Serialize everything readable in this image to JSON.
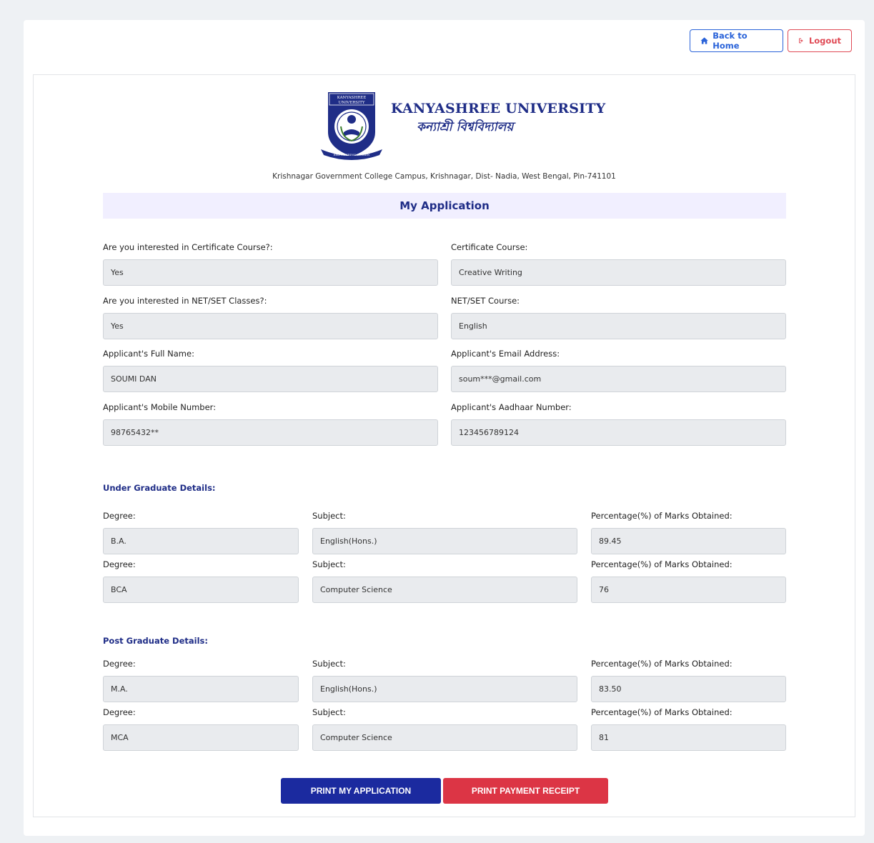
{
  "header": {
    "back_home_label": "Back to Home",
    "logout_label": "Logout"
  },
  "university": {
    "name_en": "KANYASHREE UNIVERSITY",
    "name_bn": "কন্যাশ্রী বিশ্ববিদ্যালয়",
    "logo_top_text": "KANYASHREE UNIVERSITY",
    "logo_ribbon_text": "EMPOWERING WOMEN",
    "address": "Krishnagar Government College Campus, Krishnagar, Dist- Nadia, West Bengal, Pin-741101"
  },
  "page_title": "My Application",
  "personal": {
    "cert_interest_label": "Are you interested in Certificate Course?:",
    "cert_interest_value": "Yes",
    "cert_course_label": "Certificate Course:",
    "cert_course_value": "Creative Writing",
    "netset_interest_label": "Are you interested in NET/SET Classes?:",
    "netset_interest_value": "Yes",
    "netset_course_label": "NET/SET Course:",
    "netset_course_value": "English",
    "name_label": "Applicant's Full Name:",
    "name_value": "SOUMI DAN",
    "email_label": "Applicant's Email Address:",
    "email_value": "soum***@gmail.com",
    "mobile_label": "Applicant's Mobile Number:",
    "mobile_value": "98765432**",
    "aadhaar_label": "Applicant's Aadhaar Number:",
    "aadhaar_value": "123456789124"
  },
  "ug": {
    "title": "Under Graduate Details:",
    "degree_label": "Degree:",
    "subject_label": "Subject:",
    "percent_label": "Percentage(%) of Marks Obtained:",
    "rows": [
      {
        "degree": "B.A.",
        "subject": "English(Hons.)",
        "percent": "89.45"
      },
      {
        "degree": "BCA",
        "subject": "Computer Science",
        "percent": "76"
      }
    ]
  },
  "pg": {
    "title": "Post Graduate Details:",
    "degree_label": "Degree:",
    "subject_label": "Subject:",
    "percent_label": "Percentage(%) of Marks Obtained:",
    "rows": [
      {
        "degree": "M.A.",
        "subject": "English(Hons.)",
        "percent": "83.50"
      },
      {
        "degree": "MCA",
        "subject": "Computer Science",
        "percent": "81"
      }
    ]
  },
  "actions": {
    "print_application_label": "PRINT MY APPLICATION",
    "print_receipt_label": "PRINT PAYMENT RECEIPT"
  },
  "colors": {
    "brand_navy": "#1f2d87",
    "primary_blue": "#1b2a9f",
    "danger_red": "#dc3545",
    "link_blue": "#2a63d9"
  }
}
